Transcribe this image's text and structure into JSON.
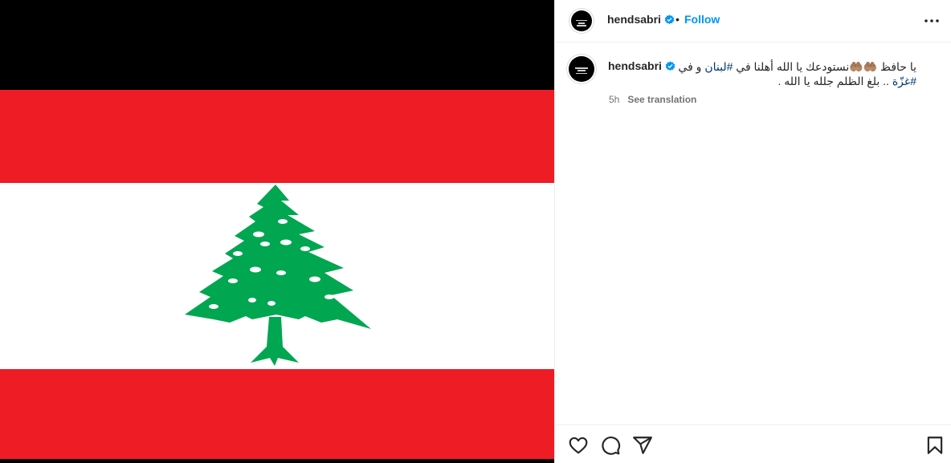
{
  "post": {
    "username": "hendsabri",
    "dot": "•",
    "follow_label": "Follow",
    "avatar_text": "HEND SABRI"
  },
  "caption": {
    "username": "hendsabri",
    "line1_prefix": "يا حافظ 🤲🏽🤲🏽نستودعك يا الله أهلنا في ",
    "hashtag1": "#لبنان",
    "line1_suffix": " و في",
    "hashtag2": "#غزّة",
    "line2_suffix": " .. بلغ الظلم جلله يا الله ."
  },
  "meta": {
    "time": "5h",
    "see_translation": "See translation"
  },
  "icons": {
    "more": "more-options-icon",
    "like": "heart-icon",
    "comment": "comment-icon",
    "share": "share-icon",
    "save": "bookmark-icon"
  },
  "colors": {
    "flag_red": "#ee1c25",
    "flag_white": "#ffffff",
    "cedar_green": "#00a650",
    "link_blue": "#0095f6",
    "verified_blue": "#0095f6"
  }
}
